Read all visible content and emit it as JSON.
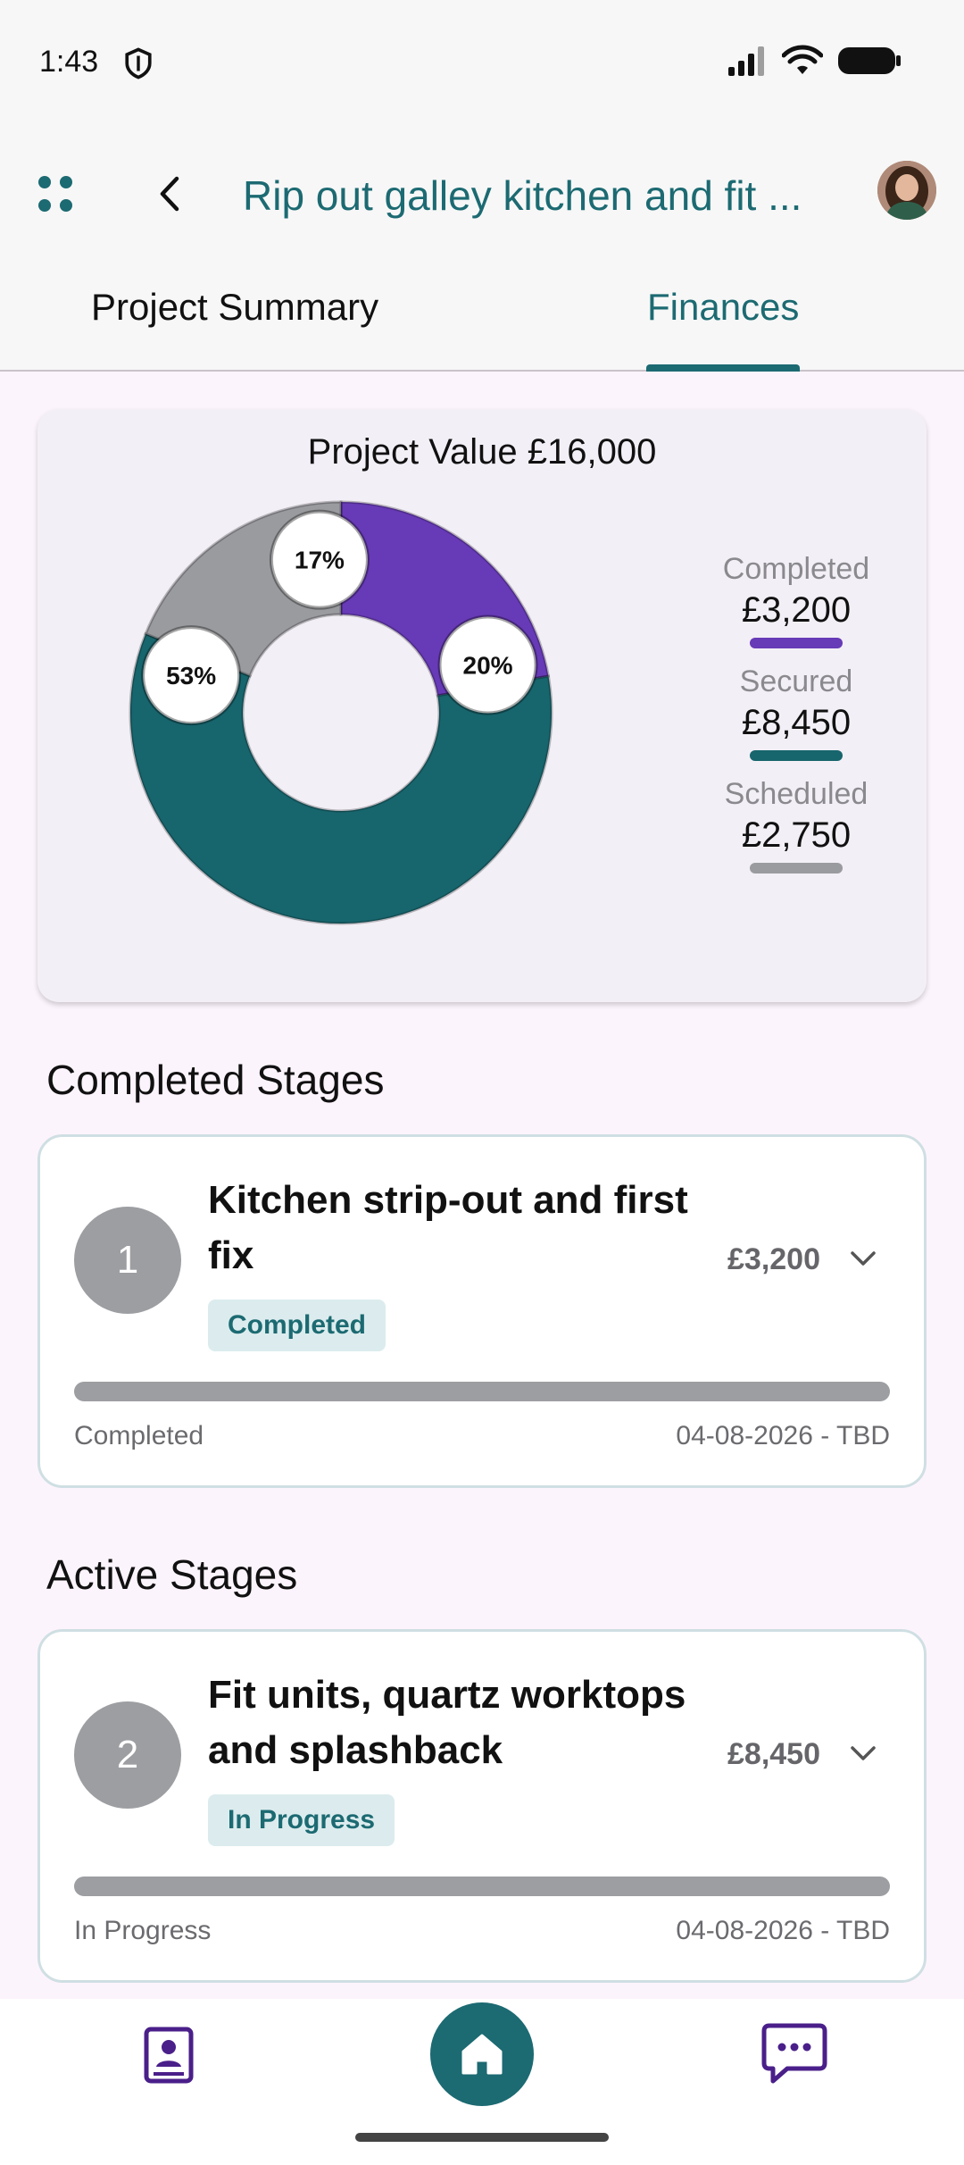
{
  "status": {
    "time": "1:43"
  },
  "header": {
    "title": "Rip out galley kitchen and fit ..."
  },
  "tabs": [
    {
      "label": "Project Summary",
      "active": false
    },
    {
      "label": "Finances",
      "active": true
    }
  ],
  "finances": {
    "title": "Project Value £16,000",
    "chart_data": {
      "type": "pie",
      "categories": [
        "Completed",
        "Secured",
        "Scheduled"
      ],
      "values": [
        20,
        53,
        17
      ],
      "labels": [
        "20%",
        "53%",
        "17%"
      ],
      "colors": [
        "#673ab7",
        "#17656d",
        "#9a9b9f"
      ]
    },
    "legend": [
      {
        "label": "Completed",
        "value": "£3,200",
        "color": "#673ab7"
      },
      {
        "label": "Secured",
        "value": "£8,450",
        "color": "#17656d"
      },
      {
        "label": "Scheduled",
        "value": "£2,750",
        "color": "#9a9b9f"
      }
    ]
  },
  "completed_section": {
    "title": "Completed Stages"
  },
  "active_section": {
    "title": "Active Stages"
  },
  "stages": [
    {
      "number": "1",
      "name": "Kitchen strip-out and first fix",
      "pill": "Completed",
      "amount": "£3,200",
      "status": "Completed",
      "dates": "04-08-2026 - TBD"
    },
    {
      "number": "2",
      "name": "Fit units, quartz worktops and splashback",
      "pill": "In Progress",
      "amount": "£8,450",
      "status": "In Progress",
      "dates": "04-08-2026 - TBD"
    }
  ],
  "icons": {
    "grid": "grid-dots-icon",
    "back": "chevron-left-icon",
    "contact": "contact-book-icon",
    "home": "home-icon",
    "chat": "chat-bubble-icon"
  }
}
